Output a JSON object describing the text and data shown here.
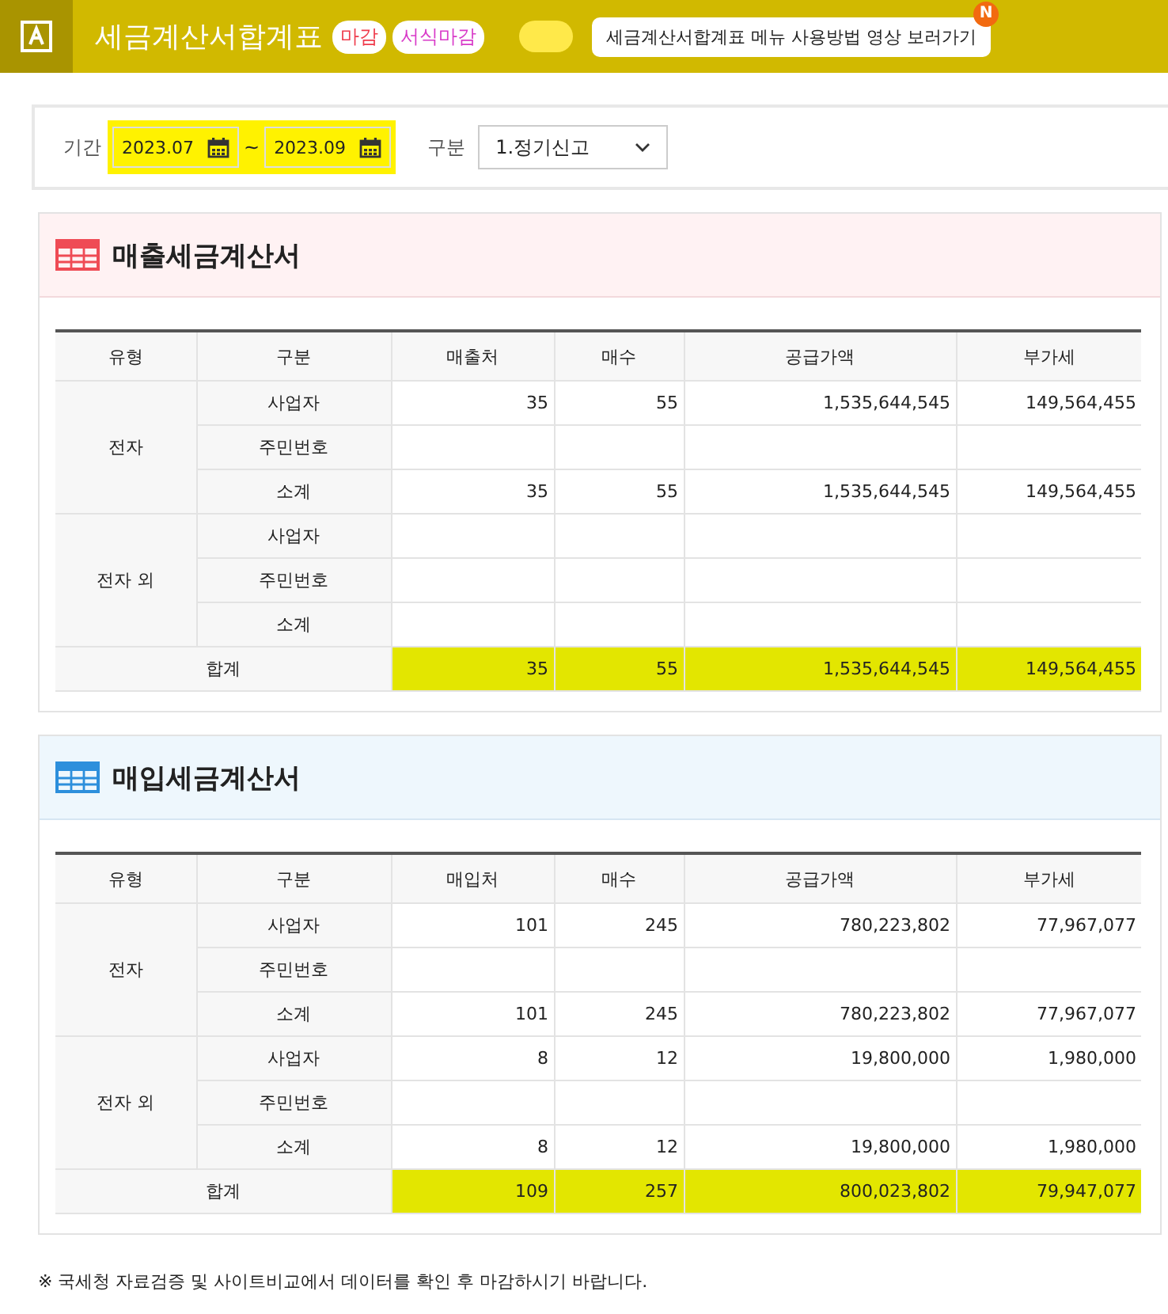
{
  "header": {
    "title": "세금계산서합계표",
    "badges": [
      {
        "label": "마감",
        "kind": "closed"
      },
      {
        "label": "서식마감",
        "kind": "form"
      }
    ],
    "toggle": {
      "on": true
    },
    "tooltip": {
      "text": "세금계산서합계표 메뉴 사용방법 영상 보러가기",
      "badge": "N"
    }
  },
  "filter": {
    "period_label": "기간",
    "from": "2023.07",
    "separator": "~",
    "to": "2023.09",
    "highlighted": true,
    "type_label": "구분",
    "type_value": "1.정기신고"
  },
  "sections": [
    {
      "title": "매출세금계산서",
      "kind": "sales",
      "columns": [
        "유형",
        "구분",
        "매출처",
        "매수",
        "공급가액",
        "부가세"
      ],
      "groups": [
        {
          "name": "전자",
          "rows": [
            [
              "사업자",
              "35",
              "55",
              "1,535,644,545",
              "149,564,455"
            ],
            [
              "주민번호",
              "",
              "",
              "",
              ""
            ],
            [
              "소계",
              "35",
              "55",
              "1,535,644,545",
              "149,564,455"
            ]
          ]
        },
        {
          "name": "전자 외",
          "rows": [
            [
              "사업자",
              "",
              "",
              "",
              ""
            ],
            [
              "주민번호",
              "",
              "",
              "",
              ""
            ],
            [
              "소계",
              "",
              "",
              "",
              ""
            ]
          ]
        }
      ],
      "total": {
        "label": "합계",
        "values": [
          "35",
          "55",
          "1,535,644,545",
          "149,564,455"
        ],
        "highlighted": true
      }
    },
    {
      "title": "매입세금계산서",
      "kind": "purchase",
      "columns": [
        "유형",
        "구분",
        "매입처",
        "매수",
        "공급가액",
        "부가세"
      ],
      "groups": [
        {
          "name": "전자",
          "rows": [
            [
              "사업자",
              "101",
              "245",
              "780,223,802",
              "77,967,077"
            ],
            [
              "주민번호",
              "",
              "",
              "",
              ""
            ],
            [
              "소계",
              "101",
              "245",
              "780,223,802",
              "77,967,077"
            ]
          ]
        },
        {
          "name": "전자 외",
          "rows": [
            [
              "사업자",
              "8",
              "12",
              "19,800,000",
              "1,980,000"
            ],
            [
              "주민번호",
              "",
              "",
              "",
              ""
            ],
            [
              "소계",
              "8",
              "12",
              "19,800,000",
              "1,980,000"
            ]
          ]
        }
      ],
      "total": {
        "label": "합계",
        "values": [
          "109",
          "257",
          "800,023,802",
          "79,947,077"
        ],
        "highlighted": true
      }
    }
  ],
  "note": "※ 국세청 자료검증 및 사이트비교에서 데이터를 확인 후 마감하시기 바랍니다."
}
